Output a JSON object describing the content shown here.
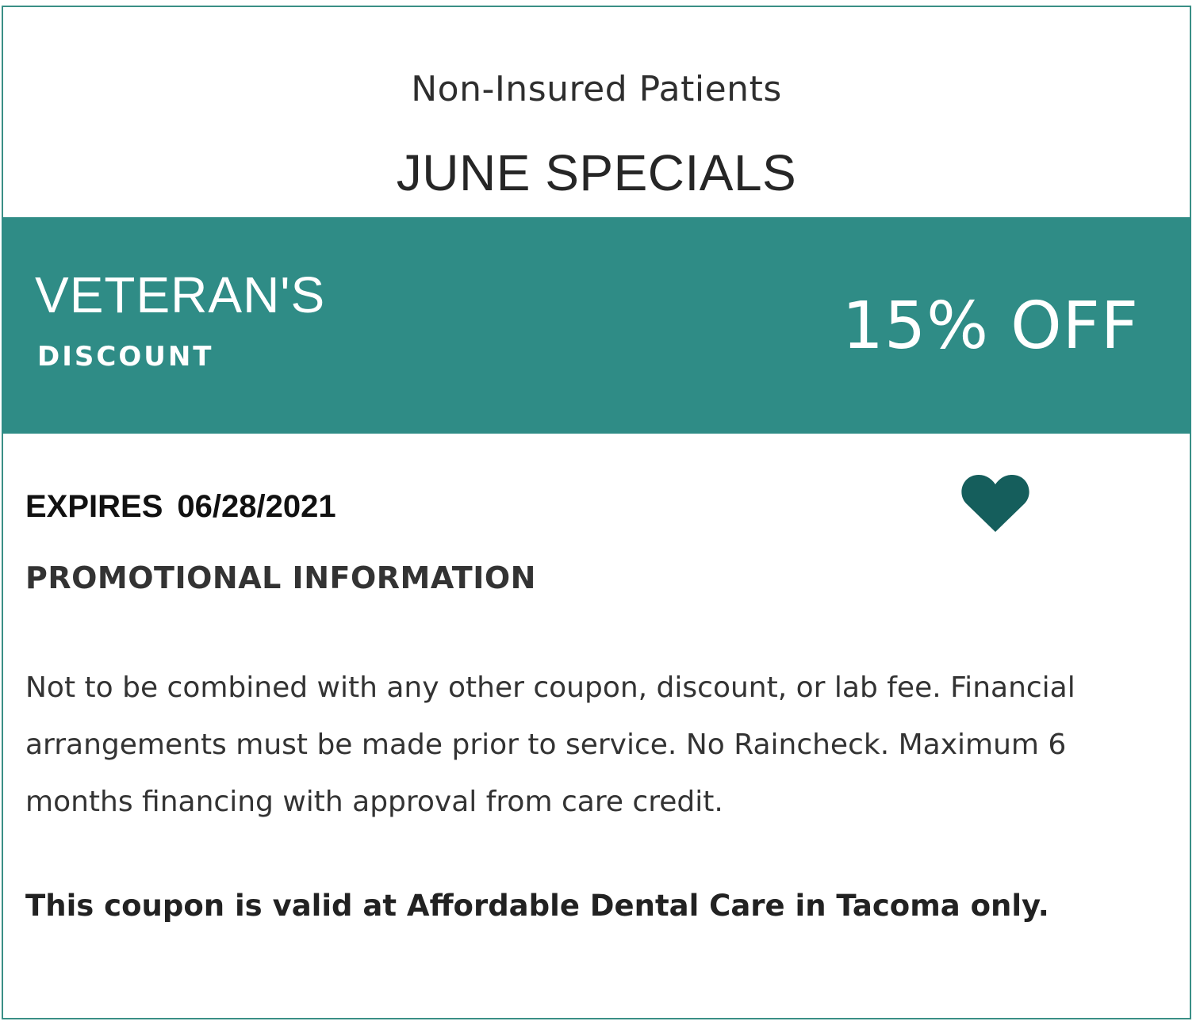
{
  "header": {
    "subtitle": "Non-Insured Patients",
    "title": "JUNE SPECIALS"
  },
  "offer": {
    "name": "VETERAN'S",
    "type": "DISCOUNT",
    "value": "15% OFF"
  },
  "details": {
    "expires_label": "EXPIRES",
    "expires_date": "06/28/2021",
    "heading": "PROMOTIONAL INFORMATION",
    "terms": "Not to be combined with any other coupon, discount, or lab fee. Financial arrangements must be made prior to service. No Raincheck. Maximum 6 months financing with approval from care credit.",
    "validity": "This coupon is valid at Affordable Dental Care in Tacoma only."
  },
  "icons": {
    "favorite": "heart-icon"
  },
  "colors": {
    "accent": "#2f8c86",
    "heart": "#155e5c",
    "border": "#3a8f86"
  }
}
